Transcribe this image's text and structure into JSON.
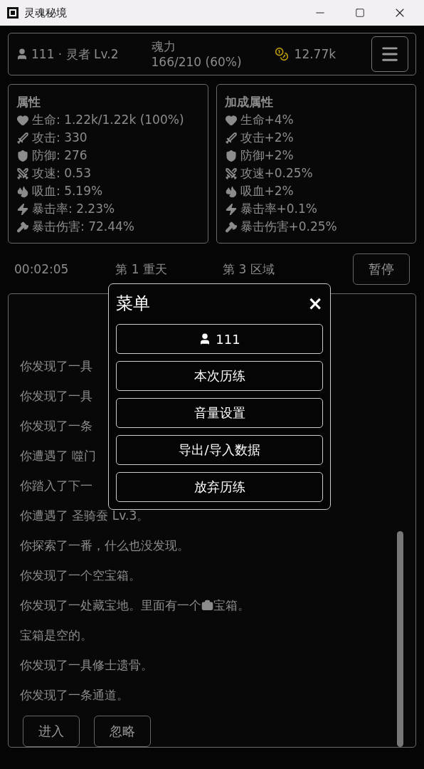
{
  "window": {
    "title": "灵魂秘境"
  },
  "header": {
    "player": "111 · 灵者 Lv.2",
    "soul_label": "魂力",
    "soul_value": "166/210 (60%)",
    "gold": "12.77k"
  },
  "stats": {
    "title": "属性",
    "items": [
      {
        "kind": "hp",
        "text": "生命: 1.22k/1.22k (100%)"
      },
      {
        "kind": "atk",
        "text": "攻击: 330"
      },
      {
        "kind": "def",
        "text": "防御: 276"
      },
      {
        "kind": "spd",
        "text": "攻速: 0.53"
      },
      {
        "kind": "vamp",
        "text": "吸血: 5.19%"
      },
      {
        "kind": "crit",
        "text": "暴击率: 2.23%"
      },
      {
        "kind": "critdmg",
        "text": "暴击伤害: 72.44%"
      }
    ]
  },
  "bonus": {
    "title": "加成属性",
    "items": [
      {
        "kind": "hp",
        "text": "生命+4%"
      },
      {
        "kind": "atk",
        "text": "攻击+2%"
      },
      {
        "kind": "def",
        "text": "防御+2%"
      },
      {
        "kind": "spd",
        "text": "攻速+0.25%"
      },
      {
        "kind": "vamp",
        "text": "吸血+2%"
      },
      {
        "kind": "crit",
        "text": "暴击率+0.1%"
      },
      {
        "kind": "critdmg",
        "text": "暴击伤害+0.25%"
      }
    ]
  },
  "status": {
    "time": "00:02:05",
    "floor": "第 1 重天",
    "area": "第 3 区域",
    "pause_button": "暂停"
  },
  "log": {
    "entries": [
      {
        "kind": "text",
        "text": "你发现了一具"
      },
      {
        "kind": "text",
        "text": "你发现了一具"
      },
      {
        "kind": "text",
        "text": "你发现了一条"
      },
      {
        "kind": "text",
        "text": "你遭遇了 噬门"
      },
      {
        "kind": "text",
        "text": "你踏入了下一"
      },
      {
        "kind": "text",
        "text": "你遭遇了 圣骑蚕 Lv.3。"
      },
      {
        "kind": "text",
        "text": "你探索了一番，什么也没发现。"
      },
      {
        "kind": "text",
        "text": "你发现了一个空宝箱。"
      },
      {
        "kind": "chest",
        "text": "你发现了一处藏宝地。里面有一个",
        "after": " 宝箱。"
      },
      {
        "kind": "text",
        "text": "宝箱是空的。"
      },
      {
        "kind": "text",
        "text": "你发现了一具修士遗骨。"
      },
      {
        "kind": "text",
        "text": "你发现了一条通道。"
      }
    ],
    "buttons": [
      "进入",
      "忽略"
    ]
  },
  "menu": {
    "title": "菜单",
    "close": "×",
    "items": [
      {
        "kind": "profile",
        "label": "111"
      },
      {
        "kind": "plain",
        "label": "本次历练"
      },
      {
        "kind": "plain",
        "label": "音量设置"
      },
      {
        "kind": "plain",
        "label": "导出/导入数据"
      },
      {
        "kind": "plain",
        "label": "放弃历练"
      }
    ]
  }
}
